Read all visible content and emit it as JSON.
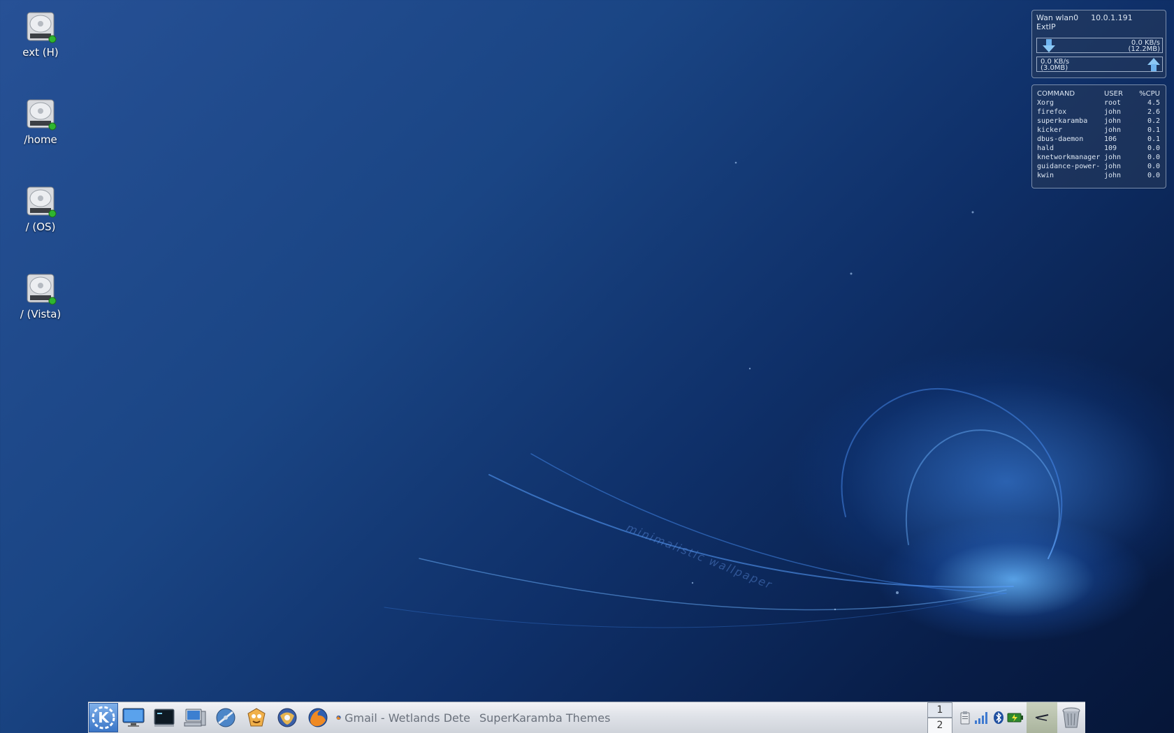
{
  "desktop": {
    "icons": [
      {
        "label": "ext (H)",
        "icon": "harddisk-icon"
      },
      {
        "label": "/home",
        "icon": "harddisk-icon"
      },
      {
        "label": "/ (OS)",
        "icon": "harddisk-icon"
      },
      {
        "label": "/ (Vista)",
        "icon": "harddisk-icon"
      }
    ],
    "wallpaper_text": "minimalistic wallpaper"
  },
  "net_widget": {
    "interface": "Wan wlan0",
    "ip": "10.0.1.191",
    "extip_label": "ExtIP",
    "down_rate": "0.0 KB/s",
    "down_total": "(12.2MB)",
    "up_rate": "0.0 KB/s",
    "up_total": "(3.0MB)"
  },
  "process_widget": {
    "headers": {
      "command": "COMMAND",
      "user": "USER",
      "cpu": "%CPU"
    },
    "rows": [
      {
        "command": "Xorg",
        "user": "root",
        "cpu": "4.5"
      },
      {
        "command": "firefox",
        "user": "john",
        "cpu": "2.6"
      },
      {
        "command": "superkaramba",
        "user": "john",
        "cpu": "0.2"
      },
      {
        "command": "kicker",
        "user": "john",
        "cpu": "0.1"
      },
      {
        "command": "dbus-daemon",
        "user": "106",
        "cpu": "0.1"
      },
      {
        "command": "hald",
        "user": "109",
        "cpu": "0.0"
      },
      {
        "command": "knetworkmanager",
        "user": "john",
        "cpu": "0.0"
      },
      {
        "command": "guidance-power-",
        "user": "john",
        "cpu": "0.0"
      },
      {
        "command": "kwin",
        "user": "john",
        "cpu": "0.0"
      }
    ]
  },
  "taskbar": {
    "launchers": [
      "kde-menu-icon",
      "desktop-monitor-icon",
      "terminal-icon",
      "computer-icon",
      "web-browser-icon",
      "media-player-icon",
      "email-client-icon",
      "firefox-icon"
    ],
    "tasks": [
      {
        "label": "Gmail - Wetlands Dete",
        "icon": "firefox-icon"
      },
      {
        "label": "SuperKaramba Themes",
        "icon": "image-viewer-icon"
      }
    ],
    "pager": [
      "1",
      "2"
    ],
    "tray": [
      "clipboard-icon",
      "wifi-signal-icon",
      "bluetooth-icon",
      "battery-icon"
    ],
    "trash_icon": "trash-icon"
  },
  "colors": {
    "desktop_bg": "#1a4584",
    "glow": "#4696ff",
    "panel_bg": "#dfe2e8",
    "kmenu_bg": "#3b76c7",
    "widget_text": "#dce6f2"
  }
}
